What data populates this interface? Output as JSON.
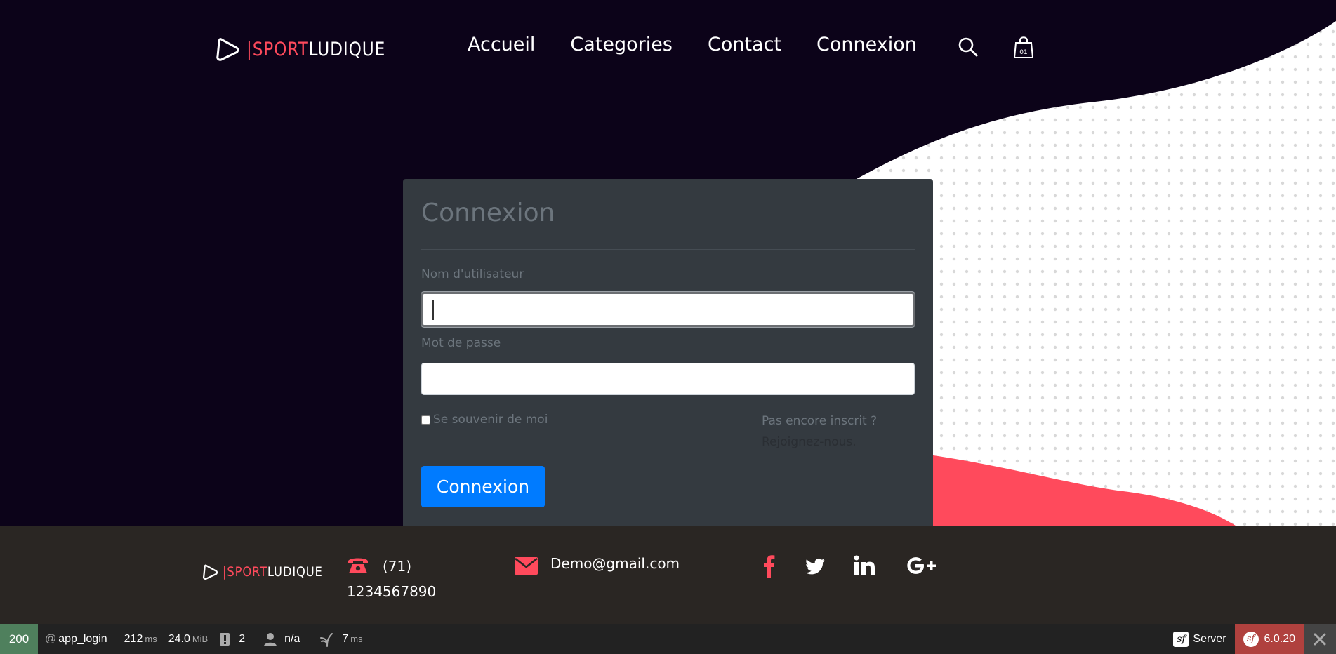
{
  "brand": {
    "sport": "SPORT",
    "ludique": "LUDIQUE"
  },
  "nav": {
    "items": [
      "Accueil",
      "Categories",
      "Contact",
      "Connexion"
    ]
  },
  "login": {
    "title": "Connexion",
    "username_label": "Nom d'utilisateur",
    "username_value": "",
    "password_label": "Mot de passe",
    "password_value": "",
    "remember_label": "Se souvenir de moi",
    "signup_line1": "Pas encore inscrit ?",
    "signup_link": "Rejoignez-nous.",
    "submit_label": "Connexion"
  },
  "footer": {
    "phone_line1": "(71)",
    "phone_line2": "1234567890",
    "email": "Demo@gmail.com",
    "social": [
      "facebook-icon",
      "twitter-icon",
      "linkedin-icon",
      "google-plus-icon"
    ]
  },
  "debug_toolbar": {
    "status": "200",
    "route": "app_login",
    "time": "212",
    "time_unit": "ms",
    "memory": "24.0",
    "memory_unit": "MiB",
    "logs": "2",
    "user": "n/a",
    "render": "7",
    "render_unit": "ms",
    "server": "Server",
    "version": "6.0.20"
  },
  "colors": {
    "accent": "#ff4a5c",
    "hero_bg": "#0c0319",
    "card_bg": "#343a40",
    "button": "#007bff",
    "footer_bg": "#2a2623"
  }
}
